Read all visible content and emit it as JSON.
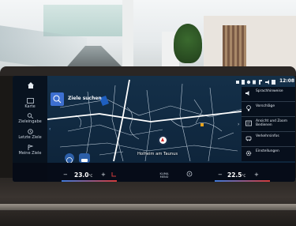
{
  "nav_rail": {
    "items": [
      {
        "label": "Karte"
      },
      {
        "label": "Zieleingabe"
      },
      {
        "label": "Letzte Ziele"
      },
      {
        "label": "Meine Ziele"
      }
    ]
  },
  "search": {
    "label": "Ziele suchen"
  },
  "status": {
    "time": "12:08"
  },
  "side_menu": {
    "items": [
      {
        "label": "Sprachhinweise",
        "icon": "speaker-icon"
      },
      {
        "label": "Vorschläge",
        "icon": "lightbulb-icon"
      },
      {
        "label": "Ansicht und Zoom Bedienen",
        "icon": "map-view-icon"
      },
      {
        "label": "Verkehrsinfos",
        "icon": "traffic-icon"
      },
      {
        "label": "Einstellungen",
        "icon": "gear-icon"
      }
    ]
  },
  "map": {
    "city_label": "Holheim am Taunus"
  },
  "climate": {
    "left_temp": "23.0",
    "right_temp": "22.5",
    "unit": "°C",
    "minus": "−",
    "plus": "+",
    "label_top": "KLIMA",
    "label_bottom": "MENÜ"
  },
  "colors": {
    "accent_blue": "#3d6fd0",
    "map_bg": "#143049",
    "marker_red": "#d52b2b"
  }
}
